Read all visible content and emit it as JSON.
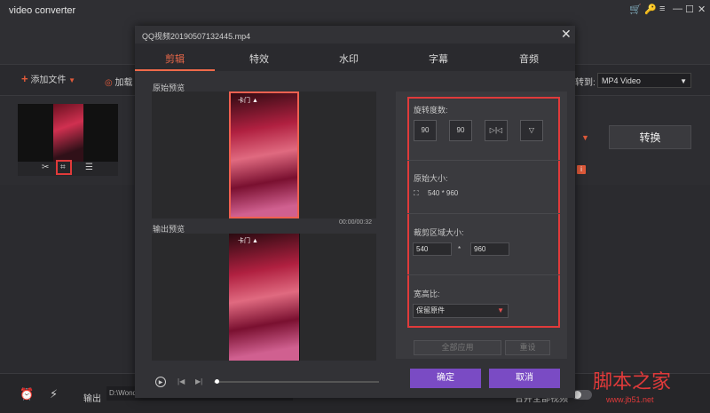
{
  "app": {
    "title": "video converter",
    "window_controls": [
      "🛒",
      "🔑",
      "≡",
      "—",
      "☐",
      "✕"
    ]
  },
  "toolbar": {
    "add_file": "添加文件",
    "load": "加载",
    "convert_to_label": "转到:",
    "format": "MP4 Video",
    "convert_button": "转换"
  },
  "bottom": {
    "output_label": "输出",
    "path": "D:\\Wondershare Video Converter Ultimate\\Converted",
    "merge_label": "合并全部视频"
  },
  "dialog": {
    "title": "QQ视频20190507132445.mp4",
    "tabs": [
      {
        "label": "剪辑",
        "active": true
      },
      {
        "label": "特效",
        "active": false
      },
      {
        "label": "水印",
        "active": false
      },
      {
        "label": "字幕",
        "active": false
      },
      {
        "label": "音频",
        "active": false
      }
    ],
    "original_preview_label": "原始预览",
    "output_preview_label": "输出预览",
    "time": "00:00/00:32",
    "video_overlay": "卡门 ▲",
    "rotate_label": "旋转度数:",
    "rotate_buttons": [
      "90",
      "90",
      "▷|◁",
      "▽"
    ],
    "original_size_label": "原始大小:",
    "original_size": "540 * 960",
    "crop_size_label": "裁剪区域大小:",
    "crop_width": "540",
    "crop_times": "*",
    "crop_height": "960",
    "aspect_label": "宽高比:",
    "aspect_value": "保留原件",
    "apply_all": "全部应用",
    "reset": "重设",
    "ok": "确定",
    "cancel": "取消"
  },
  "watermark": {
    "text": "脚本之家",
    "url": "www.jb51.net"
  },
  "colors": {
    "accent": "#f06a4a",
    "primary_button": "#7a4bc4",
    "highlight": "#e03a3a"
  }
}
